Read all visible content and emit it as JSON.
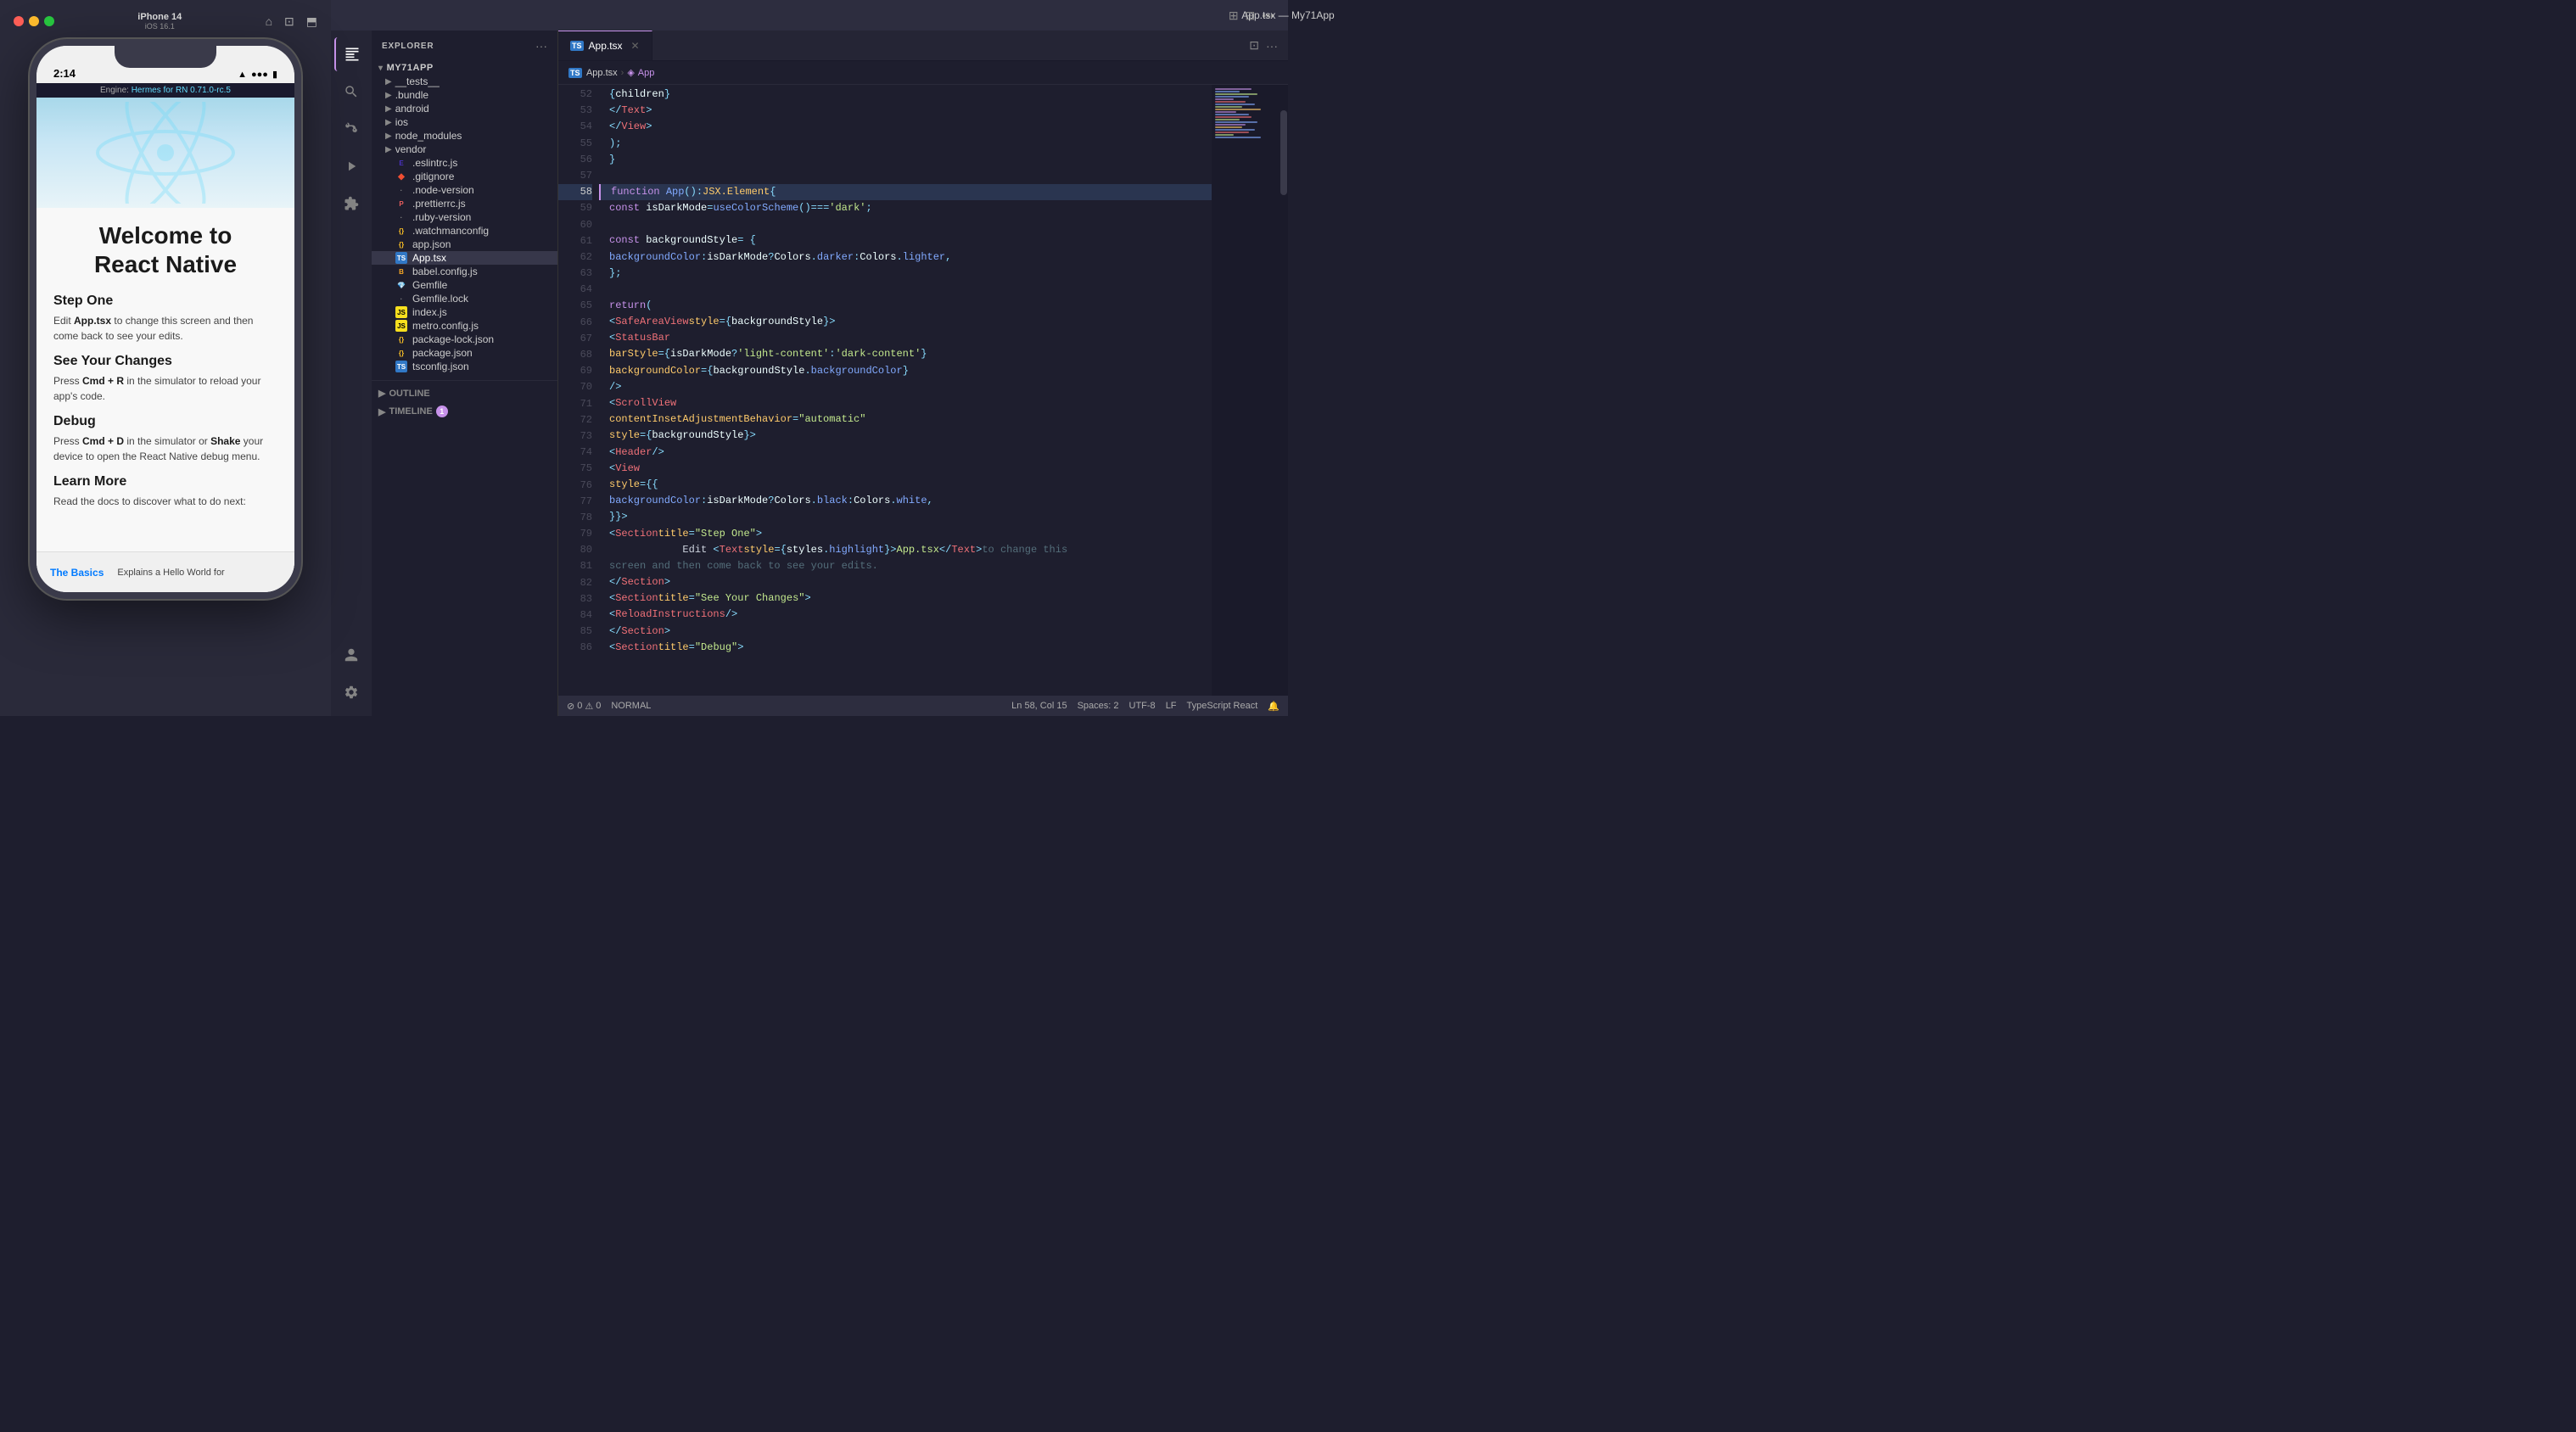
{
  "simulator": {
    "device_name": "iPhone 14",
    "device_os": "iOS 16.1",
    "time": "2:14",
    "engine_text": "Engine: Hermes",
    "engine_highlight": "Hermes",
    "engine_suffix": " for RN 0.71.0-rc.5",
    "welcome_title": "Welcome to\nReact Native",
    "step_one_title": "Step One",
    "step_one_text": "Edit App.tsx to change this screen and then come back to see your edits.",
    "see_changes_title": "See Your Changes",
    "see_changes_text": "Press Cmd + R in the simulator to reload your app's code.",
    "debug_title": "Debug",
    "debug_text": "Press Cmd + D in the simulator or Shake your device to open the React Native debug menu.",
    "learn_more_title": "Learn More",
    "learn_more_text": "Read the docs to discover what to do next:",
    "bottom_link": "The Basics",
    "bottom_desc": "Explains a Hello World for"
  },
  "vscode": {
    "titlebar": {
      "title": "App.tsx — My71App"
    },
    "sidebar": {
      "header": "Explorer",
      "root_folder": "MY71APP",
      "folders": [
        {
          "name": "__tests__",
          "indent": 1
        },
        {
          "name": ".bundle",
          "indent": 1
        },
        {
          "name": "android",
          "indent": 1
        },
        {
          "name": "ios",
          "indent": 1
        },
        {
          "name": "node_modules",
          "indent": 1
        },
        {
          "name": "vendor",
          "indent": 1
        }
      ],
      "files": [
        {
          "name": ".eslintrc.js",
          "type": "eslint"
        },
        {
          "name": ".gitignore",
          "type": "git"
        },
        {
          "name": ".node-version",
          "type": "text"
        },
        {
          "name": ".prettierrc.js",
          "type": "prettier"
        },
        {
          "name": ".ruby-version",
          "type": "ruby"
        },
        {
          "name": ".watchmanconfig",
          "type": "json"
        },
        {
          "name": "app.json",
          "type": "json"
        },
        {
          "name": "App.tsx",
          "type": "ts",
          "active": true
        },
        {
          "name": "babel.config.js",
          "type": "babel"
        },
        {
          "name": "Gemfile",
          "type": "gemfile"
        },
        {
          "name": "Gemfile.lock",
          "type": "text"
        },
        {
          "name": "index.js",
          "type": "js"
        },
        {
          "name": "metro.config.js",
          "type": "js"
        },
        {
          "name": "package-lock.json",
          "type": "json"
        },
        {
          "name": "package.json",
          "type": "json"
        },
        {
          "name": "tsconfig.json",
          "type": "ts"
        }
      ]
    },
    "tab": {
      "label": "App.tsx",
      "language": "TS"
    },
    "breadcrumb": [
      "App.tsx",
      "App"
    ],
    "status_bar": {
      "errors": "0",
      "warnings": "0",
      "mode": "NORMAL",
      "line": "Ln 58, Col 15",
      "spaces": "Spaces: 2",
      "encoding": "UTF-8",
      "eol": "LF",
      "language": "TypeScript React"
    }
  },
  "code_lines": [
    {
      "num": 52,
      "content": "        {children}"
    },
    {
      "num": 53,
      "content": "      </Text>"
    },
    {
      "num": 54,
      "content": "    </View>"
    },
    {
      "num": 55,
      "content": "  );"
    },
    {
      "num": 56,
      "content": "}"
    },
    {
      "num": 57,
      "content": ""
    },
    {
      "num": 58,
      "content": "function App(): JSX.Element {",
      "highlight": true
    },
    {
      "num": 59,
      "content": "  const isDarkMode = useColorScheme() === 'dark';"
    },
    {
      "num": 60,
      "content": ""
    },
    {
      "num": 61,
      "content": "  const backgroundStyle = {"
    },
    {
      "num": 62,
      "content": "    backgroundColor: isDarkMode ? Colors.darker : Colors.lighter,"
    },
    {
      "num": 63,
      "content": "  };"
    },
    {
      "num": 64,
      "content": ""
    },
    {
      "num": 65,
      "content": "  return ("
    },
    {
      "num": 66,
      "content": "    <SafeAreaView style={backgroundStyle}>"
    },
    {
      "num": 67,
      "content": "      <StatusBar"
    },
    {
      "num": 68,
      "content": "        barStyle={isDarkMode ? 'light-content' : 'dark-content'}"
    },
    {
      "num": 69,
      "content": "        backgroundColor={backgroundStyle.backgroundColor}"
    },
    {
      "num": 70,
      "content": "      />"
    },
    {
      "num": 71,
      "content": "      <ScrollView"
    },
    {
      "num": 72,
      "content": "        contentInsetAdjustmentBehavior=\"automatic\""
    },
    {
      "num": 73,
      "content": "        style={backgroundStyle}>"
    },
    {
      "num": 74,
      "content": "        <Header />"
    },
    {
      "num": 75,
      "content": "        <View"
    },
    {
      "num": 76,
      "content": "          style={{"
    },
    {
      "num": 77,
      "content": "            backgroundColor: isDarkMode ? Colors.black : Colors.white,"
    },
    {
      "num": 78,
      "content": "          }}>"
    },
    {
      "num": 79,
      "content": "          <Section title=\"Step One\">"
    },
    {
      "num": 80,
      "content": "            Edit <Text style={styles.highlight}>App.tsx</Text> to change this"
    },
    {
      "num": 81,
      "content": "            screen and then come back to see your edits."
    },
    {
      "num": 82,
      "content": "          </Section>"
    },
    {
      "num": 83,
      "content": "          <Section title=\"See Your Changes\">"
    },
    {
      "num": 84,
      "content": "            <ReloadInstructions />"
    },
    {
      "num": 85,
      "content": "          </Section>"
    },
    {
      "num": 86,
      "content": "          <Section title=\"Debug\">"
    }
  ]
}
